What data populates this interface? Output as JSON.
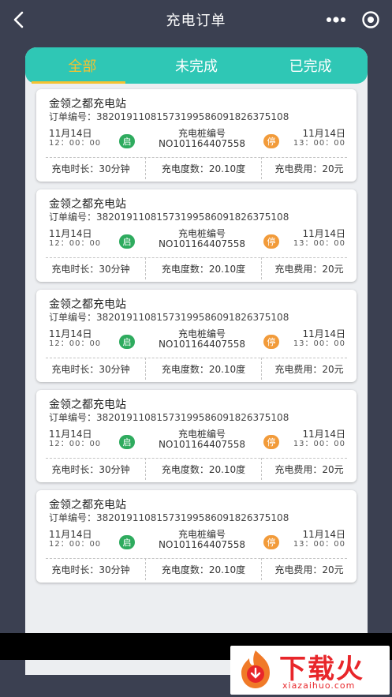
{
  "nav": {
    "title": "充电订单",
    "back_icon": "chevron-left-icon",
    "more_icon": "more-dots-icon",
    "close_icon": "target-close-icon"
  },
  "tabs": [
    {
      "label": "全部",
      "active": true
    },
    {
      "label": "未完成",
      "active": false
    },
    {
      "label": "已完成",
      "active": false
    }
  ],
  "colors": {
    "accent": "#2fc7b5",
    "active_tab": "#f5c230",
    "start_badge": "#2eab5e",
    "stop_badge": "#f29b3a"
  },
  "orders": [
    {
      "station": "金领之都充电站",
      "order_label": "订单编号：",
      "order_no": "382019110815731995860918263751​08",
      "start_date": "11月14日",
      "start_time": "12：00：00",
      "start_badge": "启",
      "pile_label": "充电桩编号",
      "pile_no": "NO101164407558",
      "stop_badge": "停",
      "end_date": "11月14日",
      "end_time": "13：00：00",
      "duration": "充电时长：30分钟",
      "kwh": "充电度数：20.10度",
      "fee": "充电费用：20元"
    },
    {
      "station": "金领之都充电站",
      "order_label": "订单编号：",
      "order_no": "38201911081573199586091826375108",
      "start_date": "11月14日",
      "start_time": "12：00：00",
      "start_badge": "启",
      "pile_label": "充电桩编号",
      "pile_no": "NO101164407558",
      "stop_badge": "停",
      "end_date": "11月14日",
      "end_time": "13：00：00",
      "duration": "充电时长：30分钟",
      "kwh": "充电度数：20.10度",
      "fee": "充电费用：20元"
    },
    {
      "station": "金领之都充电站",
      "order_label": "订单编号：",
      "order_no": "38201911081573199586091826375108",
      "start_date": "11月14日",
      "start_time": "12：00：00",
      "start_badge": "启",
      "pile_label": "充电桩编号",
      "pile_no": "NO101164407558",
      "stop_badge": "停",
      "end_date": "11月14日",
      "end_time": "13：00：00",
      "duration": "充电时长：30分钟",
      "kwh": "充电度数：20.10度",
      "fee": "充电费用：20元"
    },
    {
      "station": "金领之都充电站",
      "order_label": "订单编号：",
      "order_no": "38201911081573199586091826375108",
      "start_date": "11月14日",
      "start_time": "12：00：00",
      "start_badge": "启",
      "pile_label": "充电桩编号",
      "pile_no": "NO101164407558",
      "stop_badge": "停",
      "end_date": "11月14日",
      "end_time": "13：00：00",
      "duration": "充电时长：30分钟",
      "kwh": "充电度数：20.10度",
      "fee": "充电费用：20元"
    },
    {
      "station": "金领之都充电站",
      "order_label": "订单编号：",
      "order_no": "38201911081573199586091826375108",
      "start_date": "11月14日",
      "start_time": "12：00：00",
      "start_badge": "启",
      "pile_label": "充电桩编号",
      "pile_no": "NO101164407558",
      "stop_badge": "停",
      "end_date": "11月14日",
      "end_time": "13：00：00",
      "duration": "充电时长：30分钟",
      "kwh": "充电度数：20.10度",
      "fee": "充电费用：20元"
    }
  ],
  "watermark": {
    "text": "下载火",
    "url": "xiazaihuo.com"
  }
}
